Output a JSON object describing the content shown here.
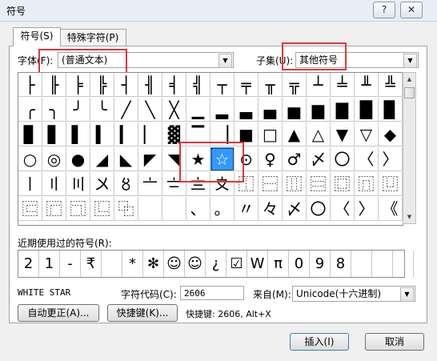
{
  "window": {
    "title": "符号",
    "help_button": "?",
    "close_button": "✕"
  },
  "tabs": [
    {
      "label": "符号(S)",
      "active": true
    },
    {
      "label": "特殊字符(P)",
      "active": false
    }
  ],
  "font": {
    "label": "字体(F):",
    "value": "(普通文本)"
  },
  "subset": {
    "label": "子集(U):",
    "value": "其他符号"
  },
  "symbols": [
    [
      "├",
      "╟",
      "╞",
      "╠",
      "┤",
      "╢",
      "╡",
      "╣",
      "┬",
      "╤",
      "╥",
      "╦",
      "┴",
      "╧",
      "╨",
      "╩"
    ],
    [
      "╭",
      "╮",
      "╯",
      "╰",
      "╱",
      "╲",
      "╳",
      "▁",
      "▂",
      "▃",
      "▄",
      "▅",
      "▆",
      "▇",
      "█",
      "▉"
    ],
    [
      "▊",
      "▋",
      "▌",
      "▍",
      "▎",
      "▏",
      "▓",
      "▔",
      "▕",
      "■",
      "□",
      "▲",
      "△",
      "▼",
      "▽",
      "◆"
    ],
    [
      "○",
      "◎",
      "●",
      "◢",
      "◣",
      "◤",
      "◥",
      "★",
      "☆",
      "⊙",
      "♀",
      "♂",
      "〆",
      "〇",
      "〈",
      "〉"
    ],
    [
      "〡",
      "〢",
      "〣",
      "〤",
      "〥",
      "〦",
      "〧",
      "〨",
      "〩",
      "⿰",
      "⿱",
      "⿲",
      "⿳",
      "⿴",
      "⿵",
      "⿶"
    ],
    [
      "⿷",
      "⿸",
      "⿹",
      "⿺",
      "⿻",
      "",
      "",
      "、",
      "。",
      "〃",
      "々",
      "〆",
      "〇",
      "〈",
      "〉",
      "《"
    ]
  ],
  "recent": {
    "label": "近期使用过的符号(R):",
    "items": [
      "2",
      "1",
      "-",
      "₹",
      "",
      "*",
      "✻",
      "☺",
      "☺",
      "¿",
      "☑",
      "W",
      "π",
      "0",
      "9",
      "8",
      "",
      "",
      ""
    ]
  },
  "char_name": "WHITE STAR",
  "char_code": {
    "label": "字符代码(C):",
    "value": "2606"
  },
  "from": {
    "label": "来自(M):",
    "value": "Unicode(十六进制)"
  },
  "buttons": {
    "autocorrect": "自动更正(A)...",
    "shortcut_key": "快捷键(K)...",
    "insert": "插入(I)",
    "cancel": "取消"
  },
  "shortcut_text": "快捷键: 2606, Alt+X",
  "colors": {
    "highlight": "#e2343c",
    "selection": "#3399ff"
  }
}
